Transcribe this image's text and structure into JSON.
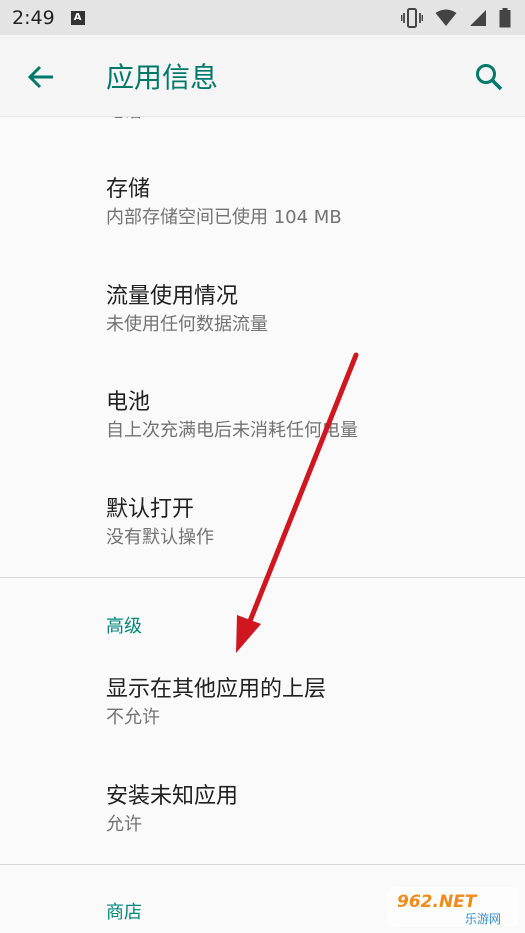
{
  "status_bar": {
    "time": "2:49",
    "badge": "A"
  },
  "app_bar": {
    "title": "应用信息"
  },
  "partial_item": {
    "title": "电话"
  },
  "items": [
    {
      "title": "存储",
      "subtitle": "内部存储空间已使用 104 MB"
    },
    {
      "title": "流量使用情况",
      "subtitle": "未使用任何数据流量"
    },
    {
      "title": "电池",
      "subtitle": "自上次充满电后未消耗任何电量"
    },
    {
      "title": "默认打开",
      "subtitle": "没有默认操作"
    }
  ],
  "sections": [
    {
      "header": "高级",
      "items": [
        {
          "title": "显示在其他应用的上层",
          "subtitle": "不允许"
        },
        {
          "title": "安装未知应用",
          "subtitle": "允许"
        }
      ]
    },
    {
      "header": "商店"
    }
  ],
  "watermark": {
    "main": "962.NET",
    "sub": "乐游网"
  },
  "colors": {
    "accent": "#00796b",
    "annotation_arrow": "#d0161e"
  }
}
